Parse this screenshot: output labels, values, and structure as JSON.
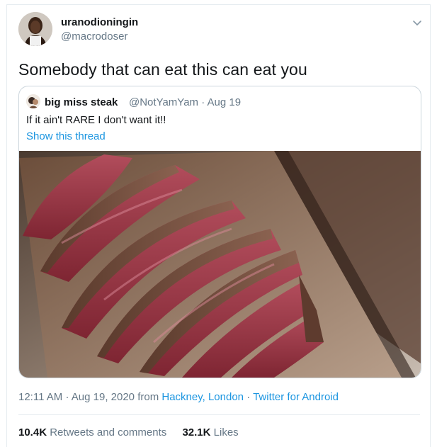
{
  "author": {
    "display_name": "uranodioningin",
    "handle": "@macrodoser"
  },
  "tweet": {
    "text": "Somebody that can eat this can eat you"
  },
  "quoted": {
    "display_name": "big miss steak",
    "handle": "@NotYamYam",
    "separator": "·",
    "date": "Aug 19",
    "text": "If it ain't RARE I don't want it!!",
    "show_thread": "Show this thread"
  },
  "meta": {
    "time": "12:11 AM",
    "dot1": "·",
    "date": "Aug 19, 2020",
    "from": "from",
    "location": "Hackney, London",
    "dot2": "·",
    "client": "Twitter for Android"
  },
  "stats": {
    "retweets_count": "10.4K",
    "retweets_label": "Retweets and comments",
    "likes_count": "32.1K",
    "likes_label": "Likes"
  },
  "colors": {
    "link": "#1b95e0",
    "secondary_text": "#657786",
    "border": "#ccd6dd"
  },
  "icons": {
    "caret": "chevron-down-icon"
  }
}
